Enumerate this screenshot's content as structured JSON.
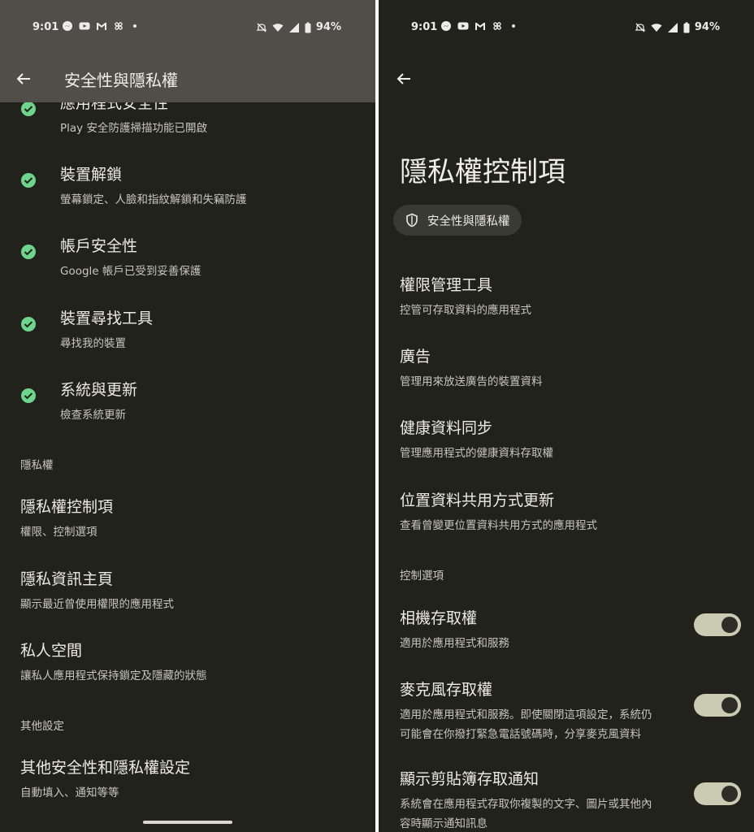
{
  "status": {
    "time": "9:01",
    "battery": "94%"
  },
  "colors": {
    "bg": "#22221d",
    "check": "#6dd58c",
    "toggle_track": "#cbcab2",
    "appbar": "#4f4e48"
  },
  "left": {
    "appbar_title": "安全性與隱私權",
    "status_items": [
      {
        "title": "應用程式安全性",
        "subtitle": "Play 安全防護掃描功能已開啟"
      },
      {
        "title": "裝置解鎖",
        "subtitle": "螢幕鎖定、人臉和指紋解鎖和失竊防護"
      },
      {
        "title": "帳戶安全性",
        "subtitle": "Google 帳戶已受到妥善保護"
      },
      {
        "title": "裝置尋找工具",
        "subtitle": "尋找我的裝置"
      },
      {
        "title": "系統與更新",
        "subtitle": "檢查系統更新"
      }
    ],
    "section_privacy": "隱私權",
    "privacy_items": [
      {
        "title": "隱私權控制項",
        "subtitle": "權限、控制選項"
      },
      {
        "title": "隱私資訊主頁",
        "subtitle": "顯示最近曾使用權限的應用程式"
      },
      {
        "title": "私人空間",
        "subtitle": "讓私人應用程式保持鎖定及隱藏的狀態"
      }
    ],
    "section_other": "其他設定",
    "other_items": [
      {
        "title": "其他安全性和隱私權設定",
        "subtitle": "自動填入、通知等等"
      }
    ]
  },
  "right": {
    "page_title": "隱私權控制項",
    "chip_label": "安全性與隱私權",
    "items": [
      {
        "title": "權限管理工具",
        "subtitle": "控管可存取資料的應用程式"
      },
      {
        "title": "廣告",
        "subtitle": "管理用來放送廣告的裝置資料"
      },
      {
        "title": "健康資料同步",
        "subtitle": "管理應用程式的健康資料存取權"
      },
      {
        "title": "位置資料共用方式更新",
        "subtitle": "查看曾變更位置資料共用方式的應用程式"
      }
    ],
    "section_controls": "控制選項",
    "toggles": [
      {
        "title": "相機存取權",
        "subtitle": "適用於應用程式和服務",
        "subtitle2": "",
        "on": true
      },
      {
        "title": "麥克風存取權",
        "subtitle": "適用於應用程式和服務。即使關閉這項設定，系統仍",
        "subtitle2": "可能會在你撥打緊急電話號碼時，分享麥克風資料",
        "on": true
      },
      {
        "title": "顯示剪貼簿存取通知",
        "subtitle": "系統會在應用程式存取你複製的文字、圖片或其他內",
        "subtitle2": "容時顯示通知訊息",
        "on": true
      }
    ]
  }
}
